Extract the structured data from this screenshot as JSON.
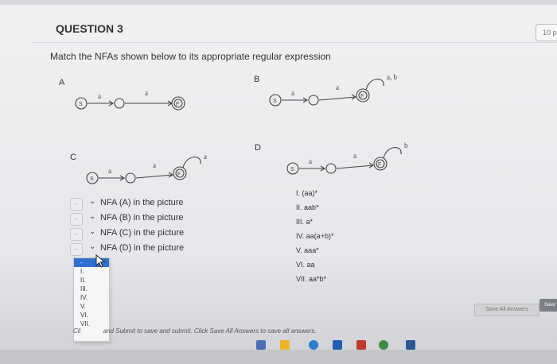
{
  "question": {
    "title": "QUESTION 3",
    "points": "10 p",
    "instruction": "Match the NFAs shown below to its appropriate regular expression"
  },
  "diagram_labels": {
    "a": "A",
    "b": "B",
    "c": "C",
    "d": "D"
  },
  "nfa": {
    "state_start": "S",
    "state_final": "F",
    "symbol_a": "a",
    "loop_ab": "a, b",
    "loop_a": "a",
    "loop_b": "b"
  },
  "matching": [
    {
      "text": "NFA (A) in the picture",
      "select_value": "-"
    },
    {
      "text": "NFA (B) in the picture",
      "select_value": "-"
    },
    {
      "text": "NFA (C) in the picture",
      "select_value": "-"
    },
    {
      "text": "NFA (D) in the picture",
      "select_value": "-"
    }
  ],
  "answers": [
    "I.   (aa)*",
    "II.  aab*",
    "III. a*",
    "IV.  aa(a+b)*",
    "V.   aaa*",
    "VI.  aa",
    "VII. aa*b*"
  ],
  "dropdown_options": [
    "-",
    "I.",
    "II.",
    "III.",
    "IV.",
    "V.",
    "VI.",
    "VII."
  ],
  "footer_left": "Cli",
  "footer_text": "and Submit to save and submit. Click Save All Answers to save all answers.",
  "buttons": {
    "save_all": "Save All Answers",
    "save": "Save"
  }
}
